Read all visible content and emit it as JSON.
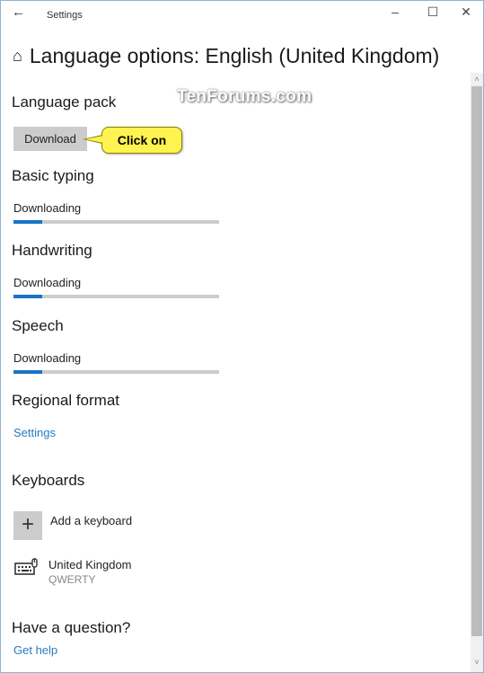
{
  "window": {
    "app_title": "Settings",
    "back_icon": "←",
    "minimize_icon": "–",
    "maximize_icon": "☐",
    "close_icon": "✕"
  },
  "page": {
    "home_icon": "⌂",
    "title": "Language options: English (United Kingdom)"
  },
  "language_pack": {
    "heading": "Language pack",
    "download_label": "Download"
  },
  "annotation": {
    "callout_text": "Click on",
    "watermark": "TenForums.com",
    "callout_color": "#fff34f"
  },
  "features": [
    {
      "heading": "Basic typing",
      "status": "Downloading",
      "progress_percent": 14
    },
    {
      "heading": "Handwriting",
      "status": "Downloading",
      "progress_percent": 14
    },
    {
      "heading": "Speech",
      "status": "Downloading",
      "progress_percent": 14
    }
  ],
  "regional_format": {
    "heading": "Regional format",
    "settings_link": "Settings"
  },
  "keyboards": {
    "heading": "Keyboards",
    "add_icon": "+",
    "add_label": "Add a keyboard",
    "items": [
      {
        "name": "United Kingdom",
        "layout": "QWERTY"
      }
    ]
  },
  "help": {
    "heading": "Have a question?",
    "link": "Get help"
  },
  "scrollbar": {
    "up_icon": "˄",
    "down_icon": "˅"
  },
  "colors": {
    "accent": "#1a73c8",
    "link": "#2a7bbd"
  }
}
